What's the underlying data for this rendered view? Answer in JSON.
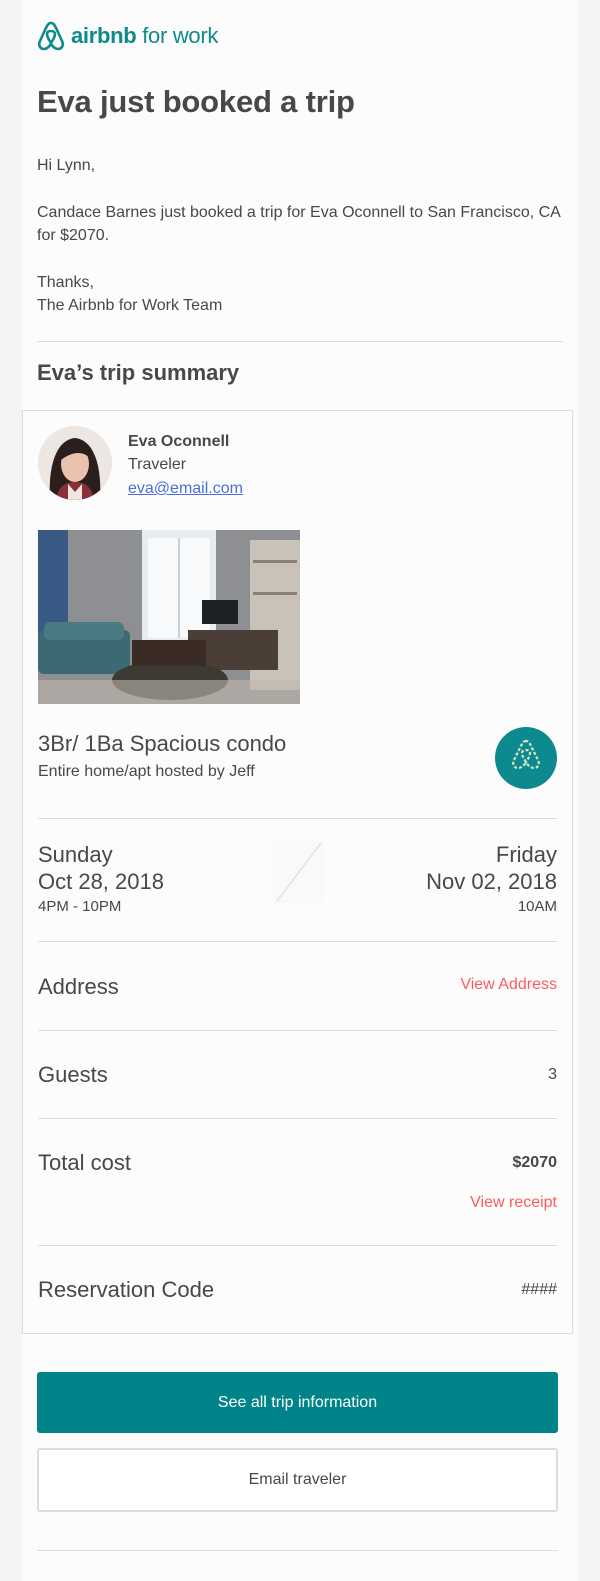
{
  "header": {
    "logo_brand": "airbnb",
    "logo_suffix": "for work"
  },
  "email": {
    "title": "Eva just booked a trip",
    "greeting": "Hi Lynn,",
    "body": "Candace Barnes just booked a trip for Eva Oconnell to San Francisco, CA for $2070.",
    "thanks": "Thanks,",
    "signature": "The Airbnb for Work Team"
  },
  "summary": {
    "heading": "Eva’s trip summary",
    "traveler": {
      "name": "Eva Oconnell",
      "role": "Traveler",
      "email": "eva@email.com"
    },
    "listing": {
      "title": "3Br/ 1Ba Spacious condo",
      "subtitle": "Entire home/apt hosted by Jeff"
    },
    "checkin": {
      "day": "Sunday",
      "date": "Oct 28, 2018",
      "time": "4PM - 10PM"
    },
    "checkout": {
      "day": "Friday",
      "date": "Nov 02, 2018",
      "time": "10AM"
    },
    "address": {
      "label": "Address",
      "link": "View Address"
    },
    "guests": {
      "label": "Guests",
      "value": "3"
    },
    "total": {
      "label": "Total cost",
      "value": "$2070",
      "link": "View receipt"
    },
    "reservation": {
      "label": "Reservation Code",
      "value": "####"
    }
  },
  "actions": {
    "primary": "See all trip information",
    "secondary": "Email traveler"
  },
  "colors": {
    "brand_teal": "#008489",
    "link_red": "#ff5a5f",
    "email_link": "#4a6fd8",
    "text": "#484848"
  }
}
